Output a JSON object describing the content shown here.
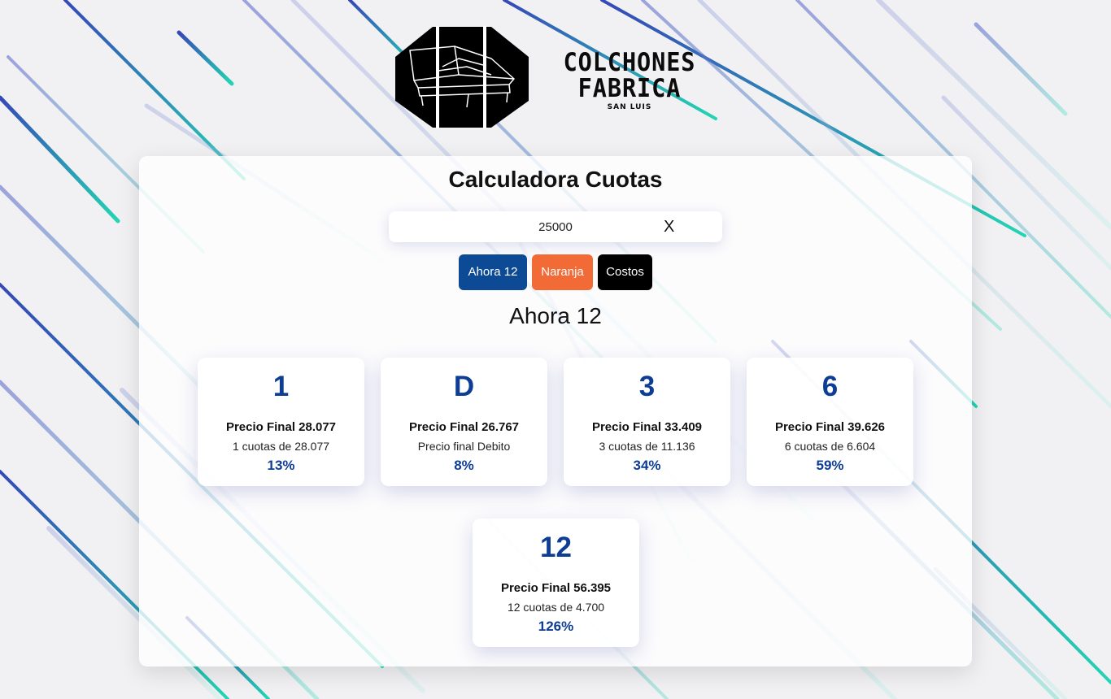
{
  "brand": {
    "line1": "COLCHONES",
    "line2": "FABRICA",
    "line3": "SAN LUIS"
  },
  "title": "Calculadora Cuotas",
  "amount": {
    "value": "25000",
    "clear_label": "X"
  },
  "buttons": [
    {
      "label": "Ahora 12",
      "color": "#0d4a96"
    },
    {
      "label": "Naranja",
      "color": "#f26a35"
    },
    {
      "label": "Costos",
      "color": "#000000"
    }
  ],
  "section_title": "Ahora 12",
  "plans": [
    {
      "num": "1",
      "final": "Precio Final 28.077",
      "detail": "1 cuotas de 28.077",
      "pct": "13%"
    },
    {
      "num": "D",
      "final": "Precio Final 26.767",
      "detail": "Precio final Debito",
      "pct": "8%"
    },
    {
      "num": "3",
      "final": "Precio Final 33.409",
      "detail": "3 cuotas de 11.136",
      "pct": "34%"
    },
    {
      "num": "6",
      "final": "Precio Final 39.626",
      "detail": "6 cuotas de 6.604",
      "pct": "59%"
    },
    {
      "num": "12",
      "final": "Precio Final 56.395",
      "detail": "12 cuotas de 4.700",
      "pct": "126%"
    }
  ],
  "colors": {
    "accent_blue": "#0d3d94",
    "stripe_blue": "#2c3fb5",
    "stripe_teal": "#19d3b0"
  }
}
